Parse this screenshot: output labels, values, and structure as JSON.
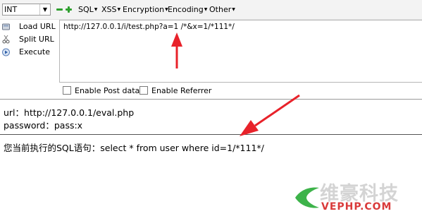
{
  "toolbar": {
    "select_value": "INT",
    "menus": [
      {
        "label": "SQL"
      },
      {
        "label": "XSS"
      },
      {
        "label": "Encryption"
      },
      {
        "label": "Encoding"
      },
      {
        "label": "Other"
      }
    ]
  },
  "sidebar": {
    "load_url": "Load URL",
    "split_url": "Split URL",
    "execute": "Execute"
  },
  "url_input": {
    "value": "http://127.0.0.1/i/test.php?a=1 /*&x=1/*111*/"
  },
  "options": {
    "post_data": "Enable Post data",
    "referrer": "Enable Referrer"
  },
  "output": {
    "url_line": "url：http://127.0.0.1/eval.php",
    "password_line": "password：pass:x",
    "sql_line": "您当前执行的SQL语句：select * from user where id=1/*111*/"
  },
  "watermark": {
    "main": "维豪科技",
    "sub": "VEPHP.COM"
  },
  "colors": {
    "arrow": "#e8222a",
    "accent_green": "#2e9f2e",
    "watermark_red": "#d93a3a"
  }
}
